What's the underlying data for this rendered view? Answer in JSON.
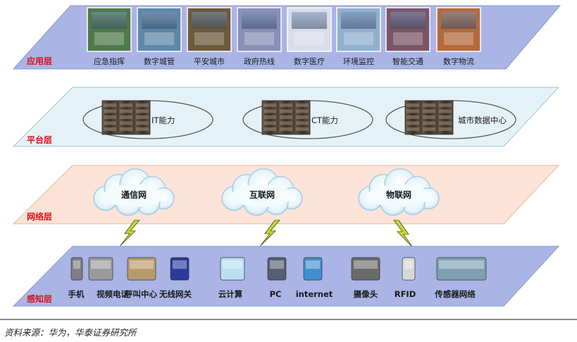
{
  "colors": {
    "app_layer": "#aab5e6",
    "platform_layer": "#e4f2f7",
    "network_layer": "#fbe3d8",
    "sense_layer": "#aab5e6",
    "label_red": "#d4141c"
  },
  "layers": {
    "app": "应用层",
    "platform": "平台层",
    "network": "网络层",
    "sense": "感知层"
  },
  "app_items": [
    {
      "label": "应急指挥",
      "icon": "emergency-command-photo"
    },
    {
      "label": "数字城管",
      "icon": "digital-city-management-photo"
    },
    {
      "label": "平安城市",
      "icon": "safe-city-photo"
    },
    {
      "label": "政府热线",
      "icon": "government-hotline-photo"
    },
    {
      "label": "数字医疗",
      "icon": "digital-medical-photo"
    },
    {
      "label": "环境监控",
      "icon": "environment-monitoring-photo"
    },
    {
      "label": "智能交通",
      "icon": "smart-traffic-photo"
    },
    {
      "label": "数字物流",
      "icon": "digital-logistics-photo"
    }
  ],
  "platform_items": [
    {
      "label": "IT能力",
      "icon": "server-rack-icon"
    },
    {
      "label": "CT能力",
      "icon": "server-rack-icon"
    },
    {
      "label": "城市数据中心",
      "icon": "server-rack-icon"
    }
  ],
  "network_items": [
    {
      "label": "通信网",
      "icon": "cloud-icon"
    },
    {
      "label": "互联网",
      "icon": "cloud-icon"
    },
    {
      "label": "物联网",
      "icon": "cloud-icon"
    }
  ],
  "sense_items": [
    {
      "label": "手机",
      "icon": "mobile-phone-icon"
    },
    {
      "label": "视频电话",
      "icon": "video-phone-icon"
    },
    {
      "label": "呼叫中心",
      "icon": "call-center-icon"
    },
    {
      "label": "无线网关",
      "icon": "wireless-gateway-icon"
    },
    {
      "label": "云计算",
      "icon": "cloud-computing-icon"
    },
    {
      "label": "PC",
      "icon": "pc-icon"
    },
    {
      "label": "internet",
      "icon": "internet-icon"
    },
    {
      "label": "摄像头",
      "icon": "camera-icon"
    },
    {
      "label": "RFID",
      "icon": "rfid-icon"
    },
    {
      "label": "传感器网络",
      "icon": "sensor-network-icon"
    }
  ],
  "source": "资料来源：华为，华泰证券研究所"
}
